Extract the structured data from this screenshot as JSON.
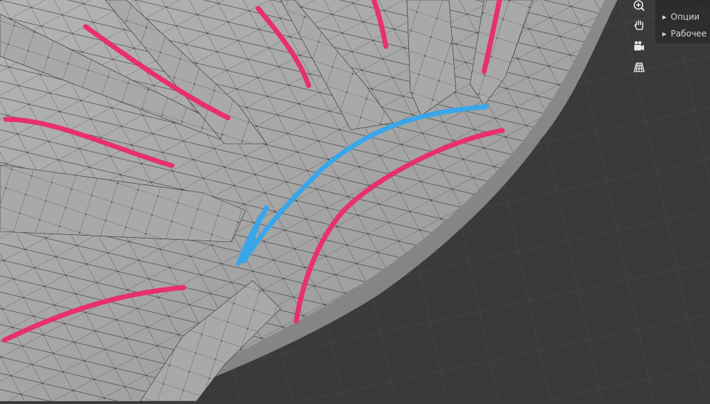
{
  "viewport": {
    "background_color": "#3a3a3a",
    "mesh_color": "#a8a8a8",
    "wire_color": "#1c1c1c",
    "annotation_red": "#e8306a",
    "annotation_blue": "#3aa6ea"
  },
  "navigation_gizmo": {
    "buttons": [
      {
        "icon": "zoom-icon"
      },
      {
        "icon": "hand-pan-icon"
      },
      {
        "icon": "camera-icon"
      },
      {
        "icon": "grid-perspective-icon"
      }
    ]
  },
  "side_panel": {
    "items": [
      {
        "label": "Опции"
      },
      {
        "label": "Рабочее г"
      }
    ]
  }
}
